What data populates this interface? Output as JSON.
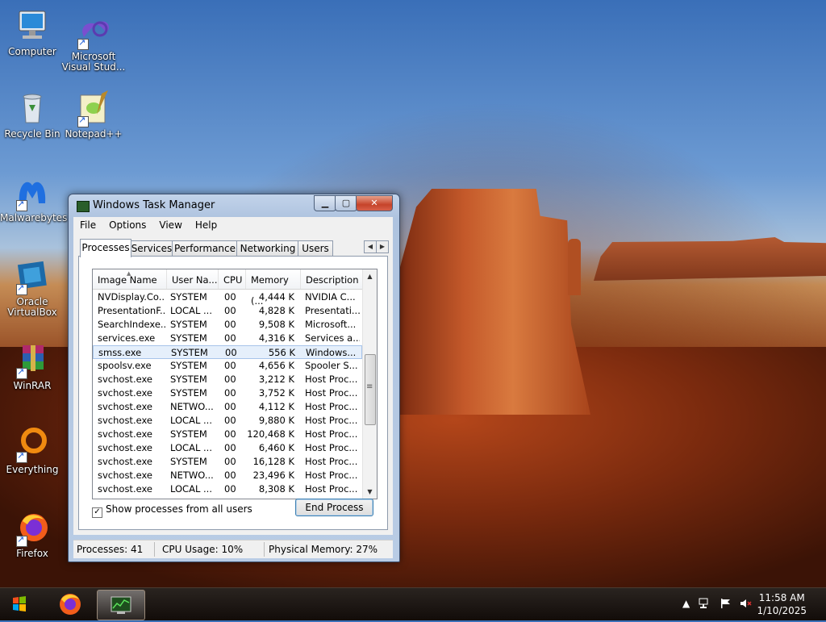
{
  "desktop": {
    "icons": [
      {
        "label": "Computer"
      },
      {
        "label": "Microsoft Visual Stud..."
      },
      {
        "label": "Recycle Bin"
      },
      {
        "label": "Notepad++"
      },
      {
        "label": "Malwarebytes"
      },
      {
        "label": "Oracle VirtualBox"
      },
      {
        "label": "WinRAR"
      },
      {
        "label": "Everything"
      },
      {
        "label": "Firefox"
      }
    ]
  },
  "window": {
    "title": "Windows Task Manager",
    "menu": [
      "File",
      "Options",
      "View",
      "Help"
    ],
    "tabs": [
      "Processes",
      "Services",
      "Performance",
      "Networking",
      "Users"
    ],
    "active_tab": "Processes",
    "columns": [
      "Image Name",
      "User Na...",
      "CPU",
      "Memory (...",
      "Description"
    ],
    "rows": [
      {
        "name": "NVDisplay.Co...",
        "user": "SYSTEM",
        "cpu": "00",
        "mem": "4,444 K",
        "desc": "NVIDIA C..."
      },
      {
        "name": "PresentationF...",
        "user": "LOCAL ...",
        "cpu": "00",
        "mem": "4,828 K",
        "desc": "Presentati..."
      },
      {
        "name": "SearchIndexe...",
        "user": "SYSTEM",
        "cpu": "00",
        "mem": "9,508 K",
        "desc": "Microsoft..."
      },
      {
        "name": "services.exe",
        "user": "SYSTEM",
        "cpu": "00",
        "mem": "4,316 K",
        "desc": "Services a..."
      },
      {
        "name": "smss.exe",
        "user": "SYSTEM",
        "cpu": "00",
        "mem": "556 K",
        "desc": "Windows..."
      },
      {
        "name": "spoolsv.exe",
        "user": "SYSTEM",
        "cpu": "00",
        "mem": "4,656 K",
        "desc": "Spooler S..."
      },
      {
        "name": "svchost.exe",
        "user": "SYSTEM",
        "cpu": "00",
        "mem": "3,212 K",
        "desc": "Host Proc..."
      },
      {
        "name": "svchost.exe",
        "user": "SYSTEM",
        "cpu": "00",
        "mem": "3,752 K",
        "desc": "Host Proc..."
      },
      {
        "name": "svchost.exe",
        "user": "NETWO...",
        "cpu": "00",
        "mem": "4,112 K",
        "desc": "Host Proc..."
      },
      {
        "name": "svchost.exe",
        "user": "LOCAL ...",
        "cpu": "00",
        "mem": "9,880 K",
        "desc": "Host Proc..."
      },
      {
        "name": "svchost.exe",
        "user": "SYSTEM",
        "cpu": "00",
        "mem": "120,468 K",
        "desc": "Host Proc..."
      },
      {
        "name": "svchost.exe",
        "user": "LOCAL ...",
        "cpu": "00",
        "mem": "6,460 K",
        "desc": "Host Proc..."
      },
      {
        "name": "svchost.exe",
        "user": "SYSTEM",
        "cpu": "00",
        "mem": "16,128 K",
        "desc": "Host Proc..."
      },
      {
        "name": "svchost.exe",
        "user": "NETWO...",
        "cpu": "00",
        "mem": "23,496 K",
        "desc": "Host Proc..."
      },
      {
        "name": "svchost.exe",
        "user": "LOCAL ...",
        "cpu": "00",
        "mem": "8,308 K",
        "desc": "Host Proc..."
      }
    ],
    "selected_row": 4,
    "show_all_label": "Show processes from all users",
    "show_all_checked": true,
    "end_process_label": "End Process",
    "status": {
      "processes": "Processes: 41",
      "cpu": "CPU Usage: 10%",
      "memory": "Physical Memory: 27%"
    }
  },
  "taskbar": {
    "time": "11:58 AM",
    "date": "1/10/2025"
  }
}
